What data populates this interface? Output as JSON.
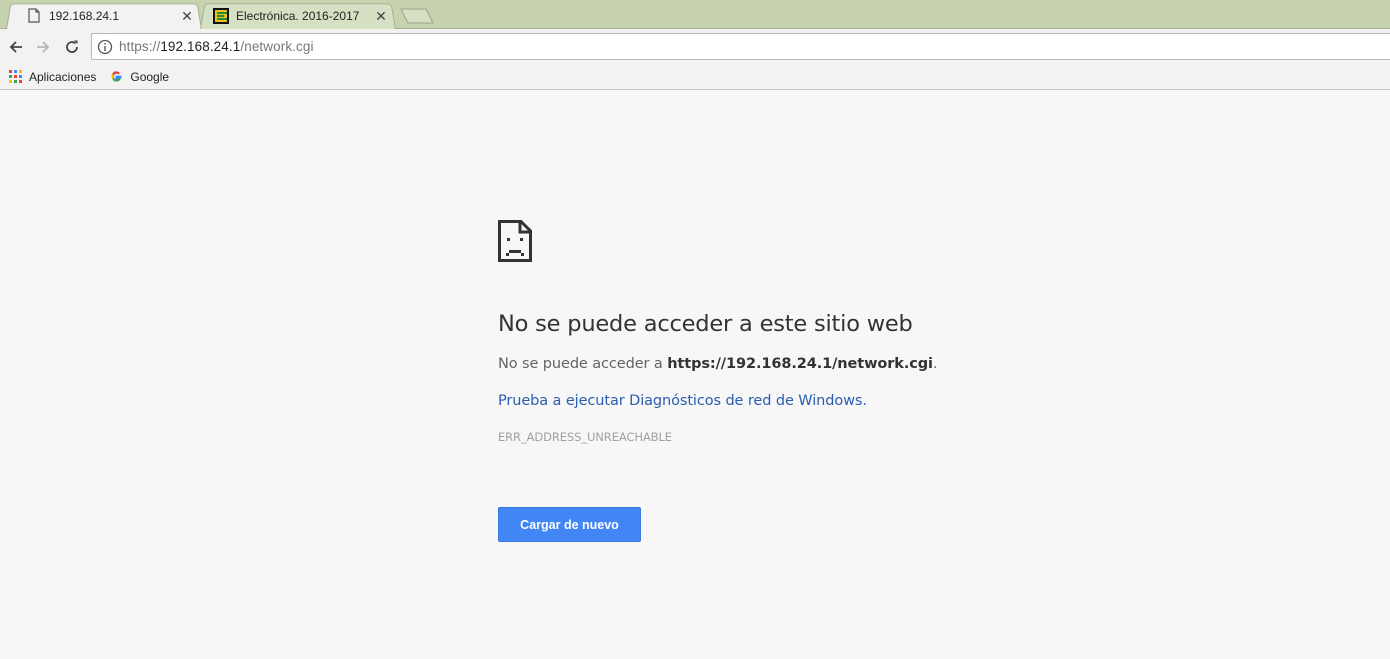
{
  "tabs": [
    {
      "title": "192.168.24.1",
      "active": true,
      "favicon": "page-icon"
    },
    {
      "title": "Electrónica. 2016-2017",
      "active": false,
      "favicon": "site-logo-icon"
    }
  ],
  "toolbar": {
    "url_scheme": "https://",
    "url_host": "192.168.24.1",
    "url_path": "/network.cgi"
  },
  "bookmarks": [
    {
      "label": "Aplicaciones",
      "icon": "apps-grid-icon"
    },
    {
      "label": "Google",
      "icon": "google-g-icon"
    }
  ],
  "error": {
    "title": "No se puede acceder a este sitio web",
    "line_prefix": "No se puede acceder a ",
    "line_url": "https://192.168.24.1/network.cgi",
    "line_suffix": ".",
    "link": "Prueba a ejecutar Diagnósticos de red de Windows.",
    "code": "ERR_ADDRESS_UNREACHABLE",
    "reload_label": "Cargar de nuevo"
  },
  "colors": {
    "tabstrip": "#c6d3ae",
    "button": "#4285f4",
    "link": "#2a5db0"
  }
}
